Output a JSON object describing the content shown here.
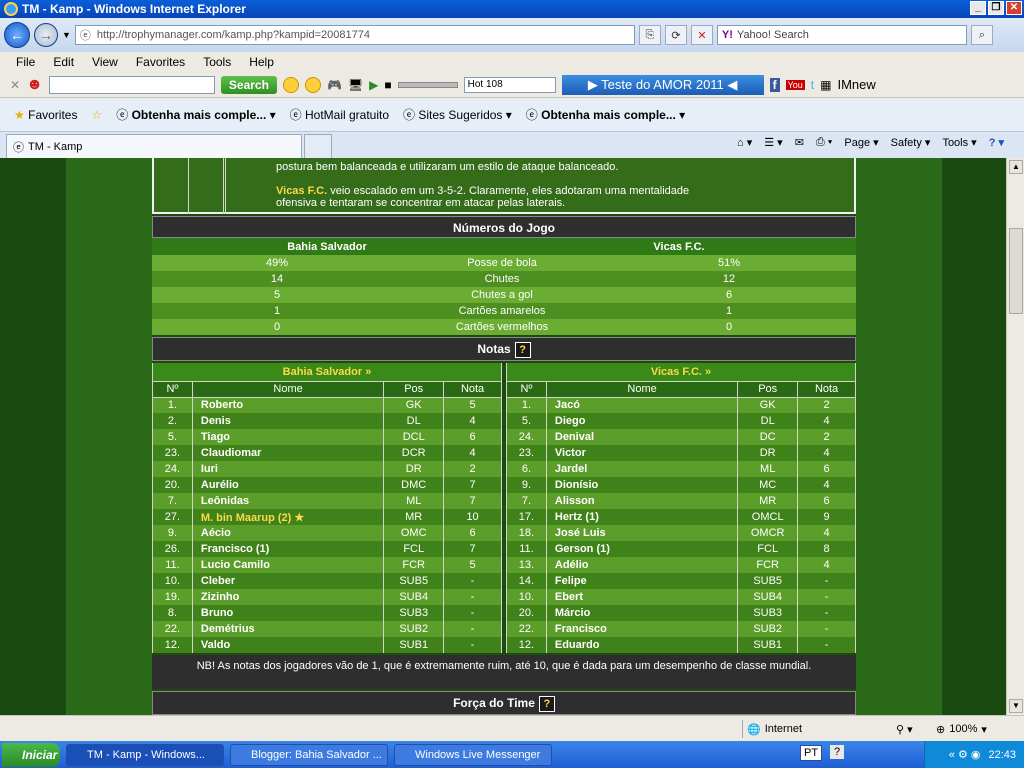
{
  "window": {
    "title": "TM - Kamp - Windows Internet Explorer"
  },
  "address": {
    "url_prefix": "http://trophymanager.com",
    "url_path": "/kamp.php?kampid=20081774",
    "search_placeholder": "Yahoo! Search"
  },
  "menu": [
    "File",
    "Edit",
    "View",
    "Favorites",
    "Tools",
    "Help"
  ],
  "toolbar": {
    "search_label": "Search",
    "radio_station": "Hot 108",
    "promo": "▶ Teste do AMOR 2011 ◀",
    "imnew": "IMnew"
  },
  "favorites": {
    "label": "Favorites",
    "items": [
      "Obtenha mais comple...",
      "HotMail gratuito",
      "Sites Sugeridos",
      "Obtenha mais comple..."
    ]
  },
  "tab": {
    "title": "TM - Kamp"
  },
  "tab_tools": {
    "page": "Page",
    "safety": "Safety",
    "tools": "Tools"
  },
  "analysis": {
    "line1": "postura bem balanceada e utilizaram um estilo de ataque balanceado.",
    "team2": "Vicas F.C.",
    "line2": " veio escalado em um 3-5-2. Claramente, eles adotaram uma mentalidade",
    "line3": "ofensiva e tentaram se concentrar em atacar pelas laterais."
  },
  "match_stats": {
    "title": "Números do Jogo",
    "home": "Bahia Salvador",
    "away": "Vicas F.C.",
    "rows": [
      {
        "home": "49%",
        "label": "Posse de bola",
        "away": "51%"
      },
      {
        "home": "14",
        "label": "Chutes",
        "away": "12"
      },
      {
        "home": "5",
        "label": "Chutes a gol",
        "away": "6"
      },
      {
        "home": "1",
        "label": "Cartões amarelos",
        "away": "1"
      },
      {
        "home": "0",
        "label": "Cartões vermelhos",
        "away": "0"
      }
    ]
  },
  "ratings": {
    "title": "Notas",
    "help": "?",
    "cols": [
      "Nº",
      "Nome",
      "Pos",
      "Nota"
    ],
    "home": {
      "team": "Bahia Salvador »",
      "players": [
        {
          "no": "1.",
          "name": "Roberto",
          "pos": "GK",
          "nota": "5"
        },
        {
          "no": "2.",
          "name": "Denis",
          "pos": "DL",
          "nota": "4"
        },
        {
          "no": "5.",
          "name": "Tiago",
          "pos": "DCL",
          "nota": "6"
        },
        {
          "no": "23.",
          "name": "Claudiomar",
          "pos": "DCR",
          "nota": "4"
        },
        {
          "no": "24.",
          "name": "Iuri",
          "pos": "DR",
          "nota": "2"
        },
        {
          "no": "20.",
          "name": "Aurélio",
          "pos": "DMC",
          "nota": "7"
        },
        {
          "no": "7.",
          "name": "Leônidas",
          "pos": "ML",
          "nota": "7"
        },
        {
          "no": "27.",
          "name": "M. bin Maarup (2) ★",
          "pos": "MR",
          "nota": "10"
        },
        {
          "no": "9.",
          "name": "Aécio",
          "pos": "OMC",
          "nota": "6"
        },
        {
          "no": "26.",
          "name": "Francisco (1)",
          "pos": "FCL",
          "nota": "7"
        },
        {
          "no": "11.",
          "name": "Lucio Camilo",
          "pos": "FCR",
          "nota": "5"
        },
        {
          "no": "10.",
          "name": "Cleber",
          "pos": "SUB5",
          "nota": "-"
        },
        {
          "no": "19.",
          "name": "Zizinho",
          "pos": "SUB4",
          "nota": "-"
        },
        {
          "no": "8.",
          "name": "Bruno",
          "pos": "SUB3",
          "nota": "-"
        },
        {
          "no": "22.",
          "name": "Demétrius",
          "pos": "SUB2",
          "nota": "-"
        },
        {
          "no": "12.",
          "name": "Valdo",
          "pos": "SUB1",
          "nota": "-"
        }
      ]
    },
    "away": {
      "team": "Vicas F.C. »",
      "players": [
        {
          "no": "1.",
          "name": "Jacó",
          "pos": "GK",
          "nota": "2"
        },
        {
          "no": "5.",
          "name": "Diego",
          "pos": "DL",
          "nota": "4"
        },
        {
          "no": "24.",
          "name": "Denival",
          "pos": "DC",
          "nota": "2"
        },
        {
          "no": "23.",
          "name": "Victor",
          "pos": "DR",
          "nota": "4"
        },
        {
          "no": "6.",
          "name": "Jardel",
          "pos": "ML",
          "nota": "6"
        },
        {
          "no": "9.",
          "name": "Dionísio",
          "pos": "MC",
          "nota": "4"
        },
        {
          "no": "7.",
          "name": "Alisson",
          "pos": "MR",
          "nota": "6"
        },
        {
          "no": "17.",
          "name": "Hertz (1)",
          "pos": "OMCL",
          "nota": "9"
        },
        {
          "no": "18.",
          "name": "José Luis",
          "pos": "OMCR",
          "nota": "4"
        },
        {
          "no": "11.",
          "name": "Gerson (1)",
          "pos": "FCL",
          "nota": "8"
        },
        {
          "no": "13.",
          "name": "Adélio",
          "pos": "FCR",
          "nota": "4"
        },
        {
          "no": "14.",
          "name": "Felipe",
          "pos": "SUB5",
          "nota": "-"
        },
        {
          "no": "10.",
          "name": "Ebert",
          "pos": "SUB4",
          "nota": "-"
        },
        {
          "no": "20.",
          "name": "Márcio",
          "pos": "SUB3",
          "nota": "-"
        },
        {
          "no": "22.",
          "name": "Francisco",
          "pos": "SUB2",
          "nota": "-"
        },
        {
          "no": "12.",
          "name": "Eduardo",
          "pos": "SUB1",
          "nota": "-"
        }
      ]
    },
    "footnote": "NB! As notas dos jogadores vão de 1, que é extremamente ruim, até 10, que é dada para um desempenho de classe mundial."
  },
  "team_strength": {
    "title": "Força do Time",
    "help": "?"
  },
  "status": {
    "zone": "Internet",
    "zoom": "100%"
  },
  "taskbar": {
    "start": "Iniciar",
    "tasks": [
      "TM - Kamp - Windows...",
      "Blogger: Bahia Salvador ...",
      "Windows Live Messenger"
    ],
    "lang": "PT",
    "clock": "22:43"
  },
  "colors": {
    "pitch_dark": "#1d4a12",
    "row_light": "#6aad32",
    "row_dark": "#4d8f20",
    "highlight": "#ffd84a"
  }
}
